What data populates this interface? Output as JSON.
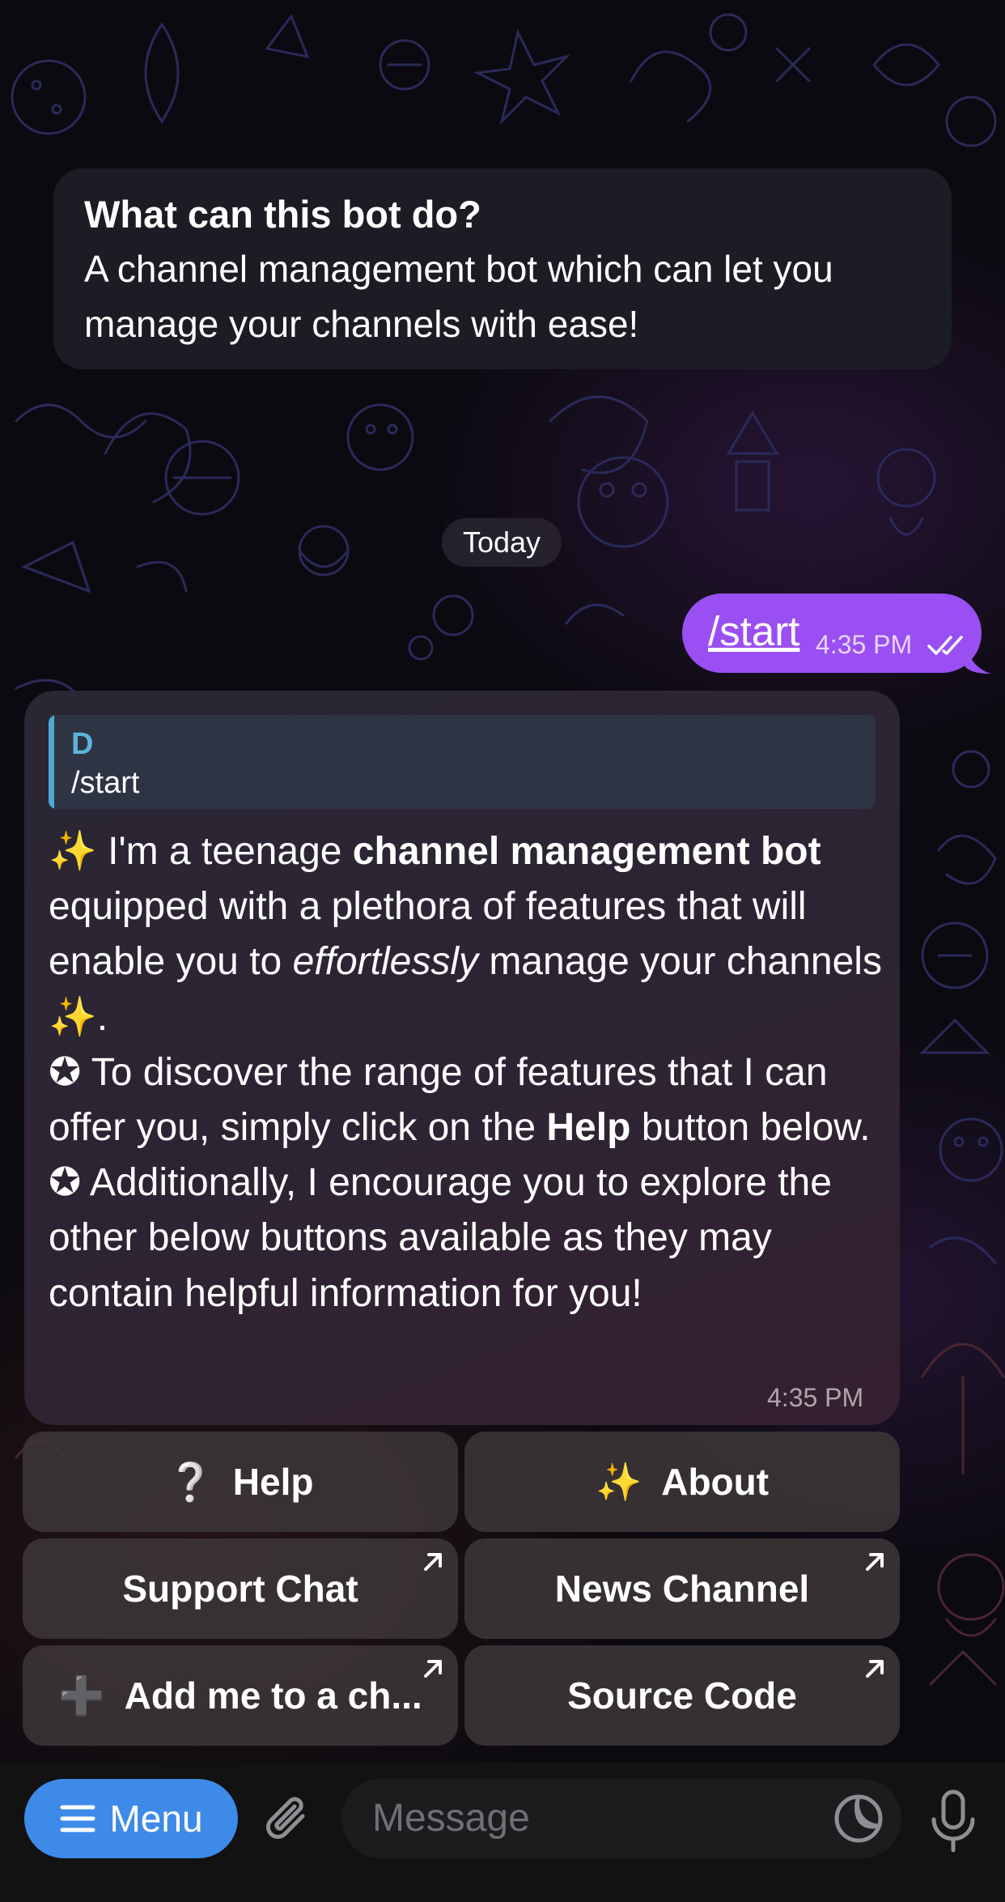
{
  "intro": {
    "title": "What can this bot do?",
    "body": "A channel management bot which can let you manage your channels with ease!"
  },
  "date_chip": "Today",
  "outgoing": {
    "text": "/start",
    "time": "4:35 PM",
    "status_icon": "double-check-icon"
  },
  "incoming": {
    "reply": {
      "name": "D",
      "text": "/start"
    },
    "sparkle": "✨",
    "star": "✪",
    "p1_a": " I'm a teenage ",
    "p1_b": "channel management bot",
    "p1_c": " equipped with a plethora of features that will enable you to ",
    "p1_d": "effortlessly",
    "p1_e": " manage your channels ",
    "p1_f": ".",
    "p2_a": " To discover the range of features that I can offer you, simply click on the ",
    "p2_b": "Help",
    "p2_c": " button below.",
    "p3": " Additionally, I encourage you to explore the other below buttons available as they may contain helpful information for you!",
    "time": "4:35 PM"
  },
  "keyboard": {
    "help": {
      "icon": "❔",
      "label": "Help"
    },
    "about": {
      "icon": "✨",
      "label": "About"
    },
    "support": {
      "label": "Support Chat"
    },
    "news": {
      "label": "News Channel"
    },
    "add": {
      "icon": "➕",
      "label": "Add me to a ch..."
    },
    "source": {
      "label": "Source Code"
    }
  },
  "bottom": {
    "menu_label": "Menu",
    "placeholder": "Message"
  },
  "colors": {
    "outgoing_bubble": "#9a4ff2",
    "menu_button": "#3d8ae8",
    "reply_accent": "#4ea9d3"
  }
}
